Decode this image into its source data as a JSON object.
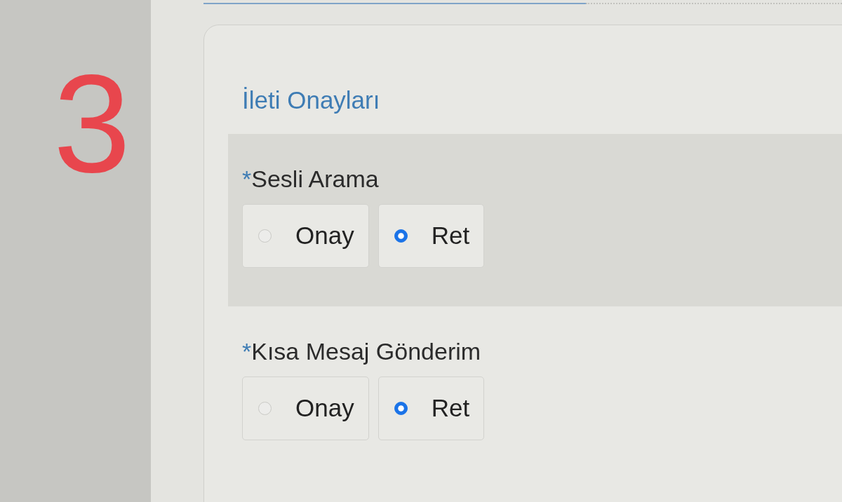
{
  "annotation": {
    "step_number": "3"
  },
  "form_section": {
    "title": "İleti Onayları",
    "questions": [
      {
        "required_mark": "*",
        "label": "Sesli Arama",
        "highlighted": true,
        "options": [
          {
            "label": "Onay",
            "selected": false
          },
          {
            "label": "Ret",
            "selected": true
          }
        ]
      },
      {
        "required_mark": "*",
        "label": "Kısa Mesaj Gönderim",
        "highlighted": false,
        "options": [
          {
            "label": "Onay",
            "selected": false
          },
          {
            "label": "Ret",
            "selected": true
          }
        ]
      }
    ]
  }
}
